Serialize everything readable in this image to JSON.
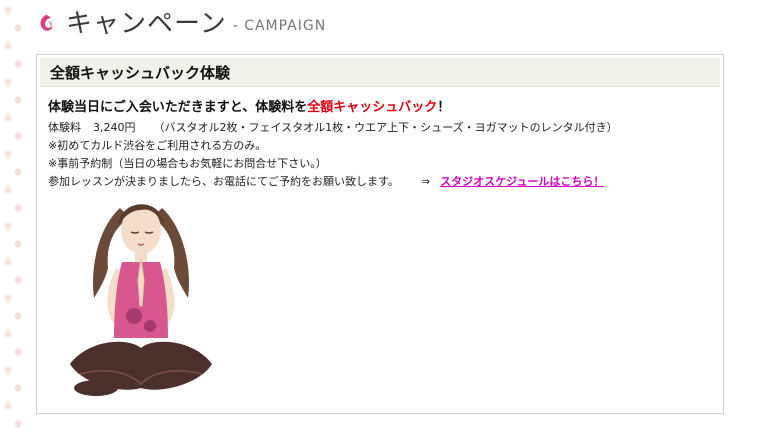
{
  "header": {
    "title": "キャンペーン",
    "subtitle": "- CAMPAIGN",
    "logo_icon": "pink-swirl-icon"
  },
  "panel": {
    "heading": "全額キャッシュバック体験",
    "lead_prefix": "体験当日にご入会いただきますと、体験料を",
    "lead_highlight": "全額キャッシュバック",
    "lead_suffix": "！",
    "fee_label": "体験料",
    "fee_price": "3,240円",
    "fee_note": "（バスタオル2枚・フェイスタオル1枚・ウエア上下・シューズ・ヨガマットのレンタル付き）",
    "note1": "※初めてカルド渋谷をご利用される方のみ。",
    "note2": "※事前予約制（当日の場合もお気軽にお問合せ下さい。）",
    "contact_text": "参加レッスンが決まりましたら、お電話にてご予約をお願い致します。",
    "arrow": "⇒",
    "schedule_link": "スタジオスケジュールはこちら！"
  },
  "colors": {
    "highlight_red": "#e60012",
    "link_magenta": "#d400c8",
    "panel_header_bg": "#f1f1ea",
    "accent_pink": "#d9417e"
  },
  "illustration": {
    "description_icon": "meditating-woman-illustration"
  }
}
